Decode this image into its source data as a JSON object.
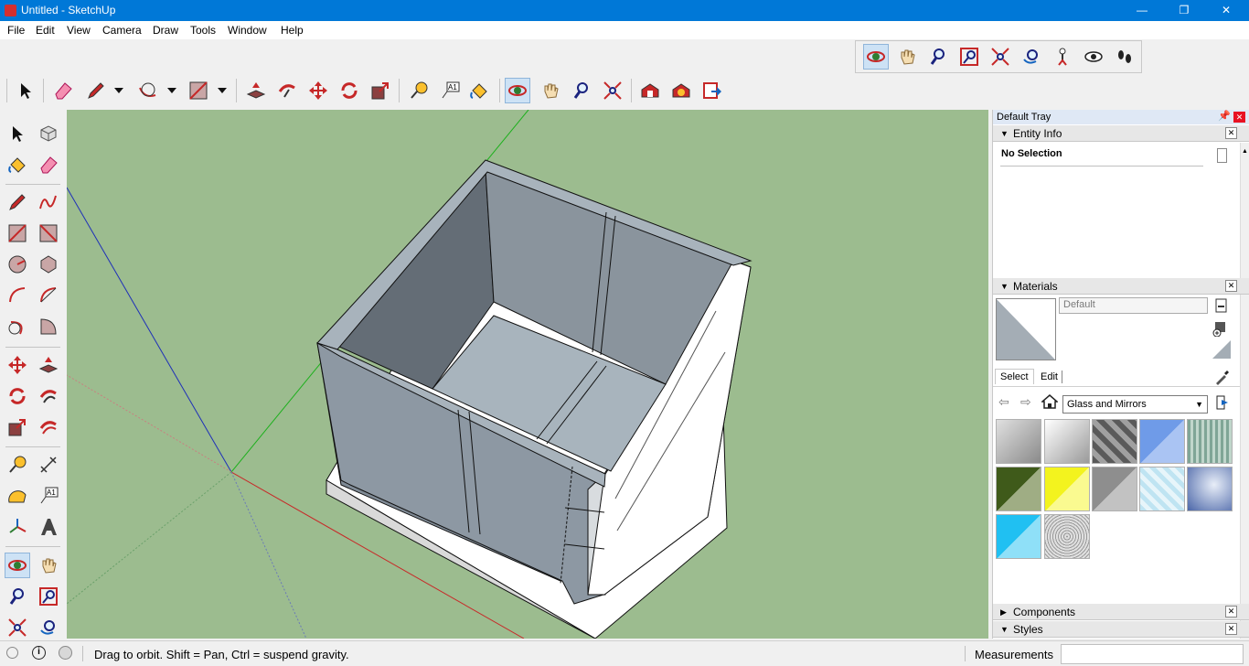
{
  "window": {
    "title": "Untitled - SketchUp",
    "minimize": "—",
    "maximize": "❐",
    "close": "✕"
  },
  "menu": [
    "File",
    "Edit",
    "View",
    "Camera",
    "Draw",
    "Tools",
    "Window",
    "Help"
  ],
  "tray": {
    "title": "Default Tray",
    "entity_info": {
      "header": "Entity Info",
      "selection": "No Selection"
    },
    "materials": {
      "header": "Materials",
      "name_value": "Default",
      "tabs": [
        "Select",
        "Edit"
      ],
      "library": "Glass and Mirrors",
      "swatch_colors": [
        "#c8c8c8",
        "#d6d6d6",
        "#8a8a8a",
        "#6f9be8",
        "#8fb0a2",
        "#3f5a1a",
        "#f3f31e",
        "#8e8e8e",
        "#bfe4f2",
        "#4b66a8",
        "#20c0f2",
        "#b8b8b8"
      ]
    },
    "components": {
      "header": "Components"
    },
    "styles": {
      "header": "Styles"
    }
  },
  "status": {
    "message": "Drag to orbit. Shift = Pan, Ctrl = suspend gravity.",
    "measurements_label": "Measurements",
    "measurements_value": ""
  }
}
